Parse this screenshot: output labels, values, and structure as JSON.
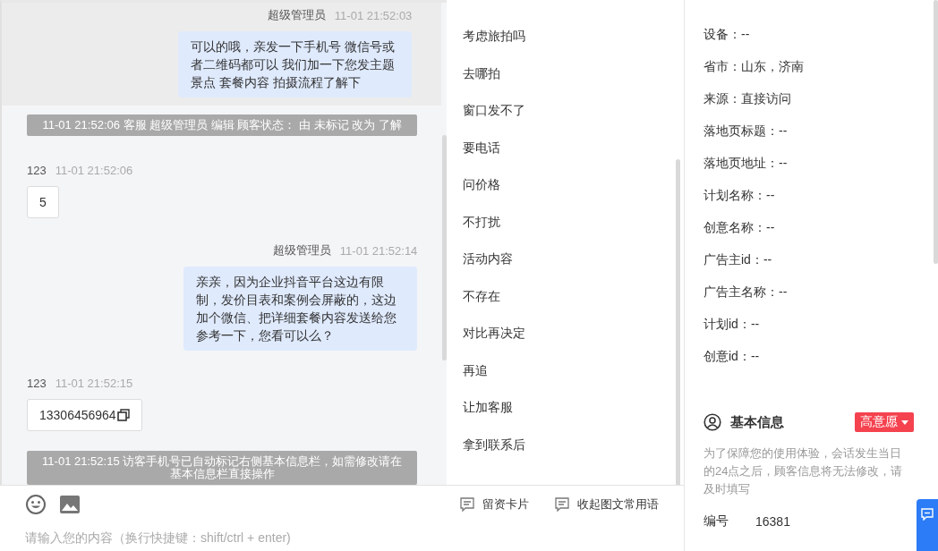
{
  "messages": [
    {
      "kind": "agent",
      "sender": "超级管理员",
      "time": "11-01 21:52:03",
      "text": "可以的哦，亲发一下手机号 微信号或者二维码都可以 我们加一下您发主题景点 套餐内容 拍摄流程了解下",
      "highlighted": true,
      "copyable": false
    },
    {
      "kind": "system",
      "text": "11-01 21:52:06 客服 超级管理员 编辑 顾客状态： 由 未标记 改为 了解"
    },
    {
      "kind": "visitor",
      "sender": "123",
      "time": "11-01 21:52:06",
      "text": "5",
      "highlighted": false,
      "copyable": false
    },
    {
      "kind": "agent",
      "sender": "超级管理员",
      "time": "11-01 21:52:14",
      "text": "亲亲，因为企业抖音平台这边有限制，发价目表和案例会屏蔽的，这边加个微信、把详细套餐内容发送给您参考一下，您看可以么？",
      "highlighted": false,
      "copyable": false
    },
    {
      "kind": "visitor",
      "sender": "123",
      "time": "11-01 21:52:15",
      "text": "13306456964",
      "highlighted": false,
      "copyable": true
    },
    {
      "kind": "system",
      "text": "11-01 21:52:15 访客手机号已自动标记右侧基本信息栏，如需修改请在基本信息栏直接操作"
    }
  ],
  "quick_replies": [
    "考虑旅拍吗",
    "去哪拍",
    "窗口发不了",
    "要电话",
    "问价格",
    "不打扰",
    "活动内容",
    "不存在",
    "对比再决定",
    "再追",
    "让加客服",
    "拿到联系后"
  ],
  "composer": {
    "tools": [
      "留资卡片",
      "收起图文常用语"
    ],
    "placeholder": "请输入您的内容（换行快捷键：shift/ctrl + enter)"
  },
  "source_info": {
    "fields": [
      "设备：--",
      "省市：山东，济南",
      "来源：直接访问",
      "落地页标题：--",
      "落地页地址：--",
      "计划名称：--",
      "创意名称：--",
      "广告主id：--",
      "广告主名称：--",
      "计划id：--",
      "创意id：--"
    ]
  },
  "basic_info": {
    "title": "基本信息",
    "intent_tag": "高意愿",
    "note": "为了保障您的使用体验，会话发生当日的24点之后，顾客信息将无法修改，请及时填写",
    "fields": [
      {
        "label": "编号",
        "value": "16381"
      }
    ]
  }
}
